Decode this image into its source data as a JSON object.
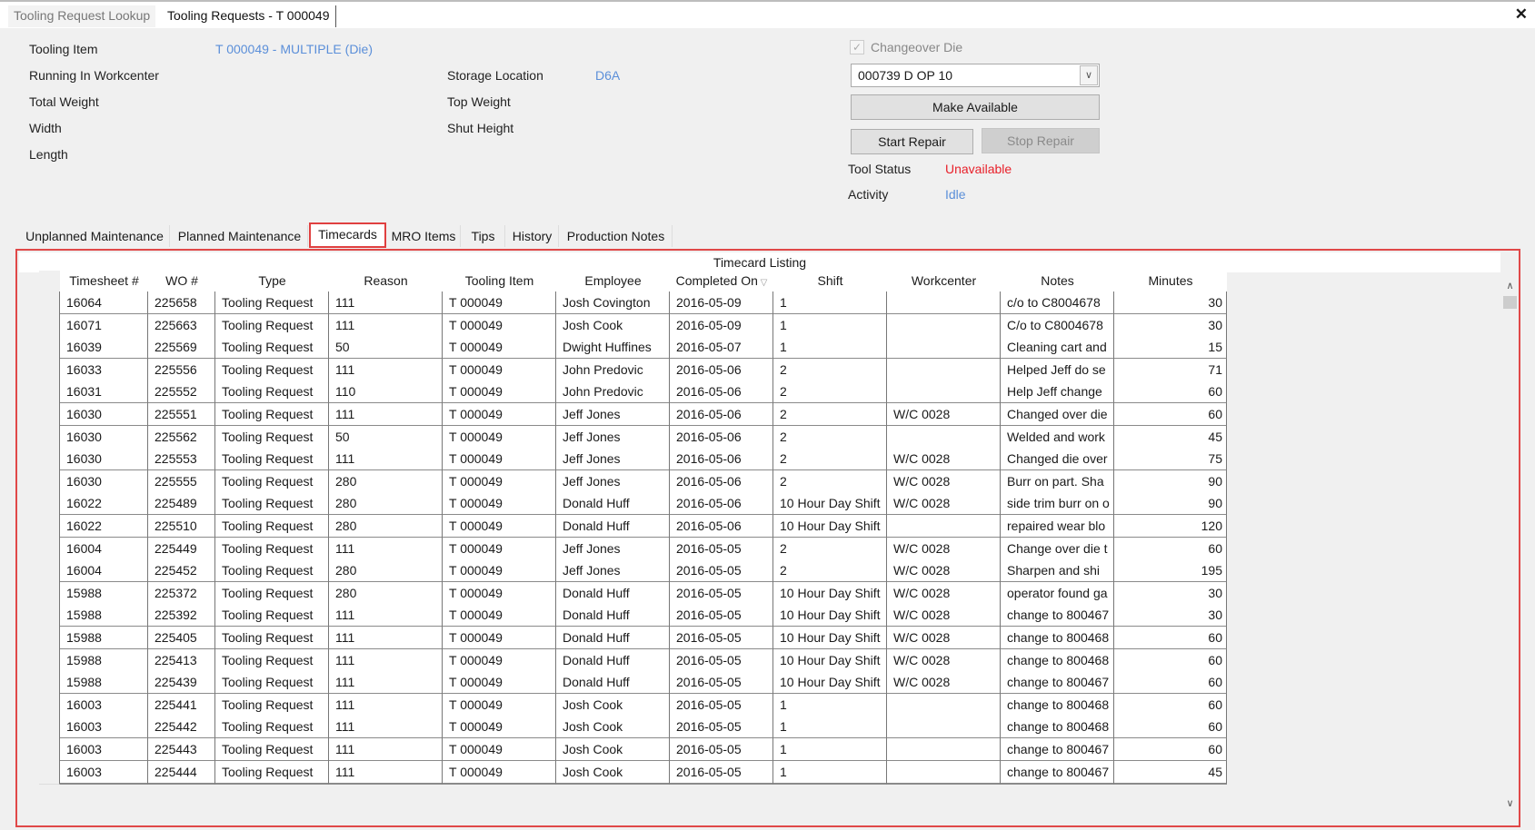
{
  "window": {
    "tabs": [
      "Tooling Request Lookup",
      "Tooling Requests - T 000049"
    ],
    "close_icon": "close-icon"
  },
  "details": {
    "tooling_item_label": "Tooling Item",
    "tooling_item_value": "T 000049 - MULTIPLE (Die)",
    "running_in_workcenter_label": "Running In Workcenter",
    "total_weight_label": "Total Weight",
    "width_label": "Width",
    "length_label": "Length",
    "storage_location_label": "Storage Location",
    "storage_location_value": "D6A",
    "top_weight_label": "Top Weight",
    "shut_height_label": "Shut Height"
  },
  "controls": {
    "changeover_die_label": "Changeover Die",
    "changeover_die_checked": true,
    "die_select_value": "000739 D  OP 10",
    "make_available": "Make Available",
    "start_repair": "Start Repair",
    "stop_repair": "Stop Repair",
    "tool_status_label": "Tool Status",
    "tool_status_value": "Unavailable",
    "activity_label": "Activity",
    "activity_value": "Idle",
    "colors": {
      "link": "#5b8fd9",
      "status_unavailable": "#e8202a",
      "highlight": "#e04848"
    }
  },
  "panel_tabs": [
    "Unplanned Maintenance",
    "Planned Maintenance",
    "Timecards",
    "MRO Items",
    "Tips",
    "History",
    "Production Notes"
  ],
  "active_tab": "Timecards",
  "grid": {
    "caption": "Timecard Listing",
    "columns": [
      "Timesheet #",
      "WO #",
      "Type",
      "Reason",
      "Tooling Item",
      "Employee",
      "Completed On",
      "Shift",
      "Workcenter",
      "Notes",
      "Minutes"
    ],
    "sort_column": "Completed On",
    "sort_direction": "descending",
    "rows": [
      [
        "16064",
        "225658",
        "Tooling Request",
        "111",
        "T 000049",
        "Josh Covington",
        "2016-05-09",
        "1",
        "",
        "c/o to C8004678",
        "30"
      ],
      [
        "16071",
        "225663",
        "Tooling Request",
        "111",
        "T 000049",
        "Josh Cook",
        "2016-05-09",
        "1",
        "",
        "C/o to C8004678",
        "30"
      ],
      [
        "16039",
        "225569",
        "Tooling Request",
        "50",
        "T 000049",
        "Dwight Huffines",
        "2016-05-07",
        "1",
        "",
        "Cleaning cart and",
        "15"
      ],
      [
        "16033",
        "225556",
        "Tooling Request",
        "111",
        "T 000049",
        "John Predovic",
        "2016-05-06",
        "2",
        "",
        "Helped Jeff do se",
        "71"
      ],
      [
        "16031",
        "225552",
        "Tooling Request",
        "110",
        "T 000049",
        "John Predovic",
        "2016-05-06",
        "2",
        "",
        "Help Jeff change",
        "60"
      ],
      [
        "16030",
        "225551",
        "Tooling Request",
        "111",
        "T 000049",
        "Jeff Jones",
        "2016-05-06",
        "2",
        "W/C 0028",
        "Changed over die",
        "60"
      ],
      [
        "16030",
        "225562",
        "Tooling Request",
        "50",
        "T 000049",
        "Jeff Jones",
        "2016-05-06",
        "2",
        "",
        "Welded and work",
        "45"
      ],
      [
        "16030",
        "225553",
        "Tooling Request",
        "111",
        "T 000049",
        "Jeff Jones",
        "2016-05-06",
        "2",
        "W/C 0028",
        "Changed die over",
        "75"
      ],
      [
        "16030",
        "225555",
        "Tooling Request",
        "280",
        "T 000049",
        "Jeff Jones",
        "2016-05-06",
        "2",
        "W/C 0028",
        "Burr on part.  Sha",
        "90"
      ],
      [
        "16022",
        "225489",
        "Tooling Request",
        "280",
        "T 000049",
        "Donald Huff",
        "2016-05-06",
        "10 Hour Day Shift",
        "W/C 0028",
        "side trim burr on o",
        "90"
      ],
      [
        "16022",
        "225510",
        "Tooling Request",
        "280",
        "T 000049",
        "Donald Huff",
        "2016-05-06",
        "10 Hour Day Shift",
        "",
        "repaired wear blo",
        "120"
      ],
      [
        "16004",
        "225449",
        "Tooling Request",
        "111",
        "T 000049",
        "Jeff Jones",
        "2016-05-05",
        "2",
        "W/C 0028",
        "Change over die t",
        "60"
      ],
      [
        "16004",
        "225452",
        "Tooling Request",
        "280",
        "T 000049",
        "Jeff Jones",
        "2016-05-05",
        "2",
        "W/C 0028",
        "Sharpen and shi",
        "195"
      ],
      [
        "15988",
        "225372",
        "Tooling Request",
        "280",
        "T 000049",
        "Donald Huff",
        "2016-05-05",
        "10 Hour Day Shift",
        "W/C 0028",
        "operator found ga",
        "30"
      ],
      [
        "15988",
        "225392",
        "Tooling Request",
        "111",
        "T 000049",
        "Donald Huff",
        "2016-05-05",
        "10 Hour Day Shift",
        "W/C 0028",
        "change to 800467",
        "30"
      ],
      [
        "15988",
        "225405",
        "Tooling Request",
        "111",
        "T 000049",
        "Donald Huff",
        "2016-05-05",
        "10 Hour Day Shift",
        "W/C 0028",
        "change to 800468",
        "60"
      ],
      [
        "15988",
        "225413",
        "Tooling Request",
        "111",
        "T 000049",
        "Donald Huff",
        "2016-05-05",
        "10 Hour Day Shift",
        "W/C 0028",
        "change to 800468",
        "60"
      ],
      [
        "15988",
        "225439",
        "Tooling Request",
        "111",
        "T 000049",
        "Donald Huff",
        "2016-05-05",
        "10 Hour Day Shift",
        "W/C 0028",
        "change to 800467",
        "60"
      ],
      [
        "16003",
        "225441",
        "Tooling Request",
        "111",
        "T 000049",
        "Josh Cook",
        "2016-05-05",
        "1",
        "",
        "change to 800468",
        "60"
      ],
      [
        "16003",
        "225442",
        "Tooling Request",
        "111",
        "T 000049",
        "Josh Cook",
        "2016-05-05",
        "1",
        "",
        "change to 800468",
        "60"
      ],
      [
        "16003",
        "225443",
        "Tooling Request",
        "111",
        "T 000049",
        "Josh Cook",
        "2016-05-05",
        "1",
        "",
        "change to 800467",
        "60"
      ],
      [
        "16003",
        "225444",
        "Tooling Request",
        "111",
        "T 000049",
        "Josh Cook",
        "2016-05-05",
        "1",
        "",
        "change to 800467",
        "45"
      ]
    ]
  }
}
